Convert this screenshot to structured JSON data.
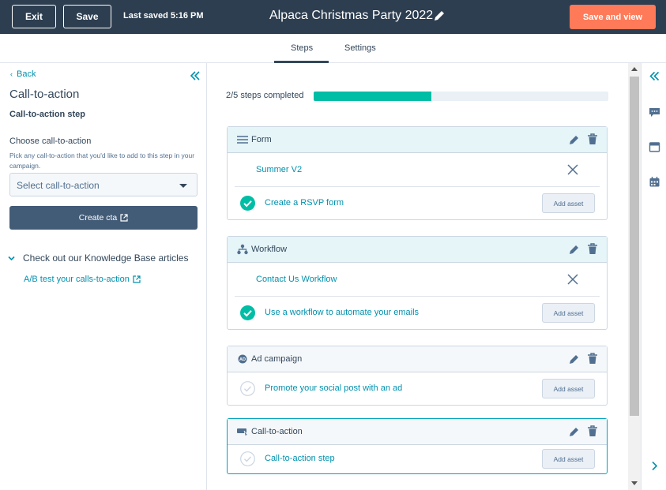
{
  "header": {
    "exit_label": "Exit",
    "save_label": "Save",
    "last_saved": "Last saved 5:16 PM",
    "title": "Alpaca Christmas Party 2022",
    "save_view_label": "Save and view"
  },
  "tabs": [
    {
      "label": "Steps",
      "active": true
    },
    {
      "label": "Settings",
      "active": false
    }
  ],
  "left_panel": {
    "back_label": "Back",
    "title": "Call-to-action",
    "subtitle": "Call-to-action step",
    "choose_label": "Choose call-to-action",
    "help_text": "Pick any call-to-action that you'd like to add to this step in your campaign.",
    "select_placeholder": "Select call-to-action",
    "create_cta_label": "Create cta",
    "kb_header": "Check out our Knowledge Base articles",
    "kb_link": "A/B test your calls-to-action"
  },
  "progress": {
    "label": "2/5 steps completed",
    "completed": 2,
    "total": 5,
    "fraction": 0.4
  },
  "steps": [
    {
      "title": "Form",
      "icon": "list-icon",
      "asset": "Summer V2",
      "task": "Create a RSVP form",
      "task_done": true,
      "add_label": "Add asset"
    },
    {
      "title": "Workflow",
      "icon": "workflow-icon",
      "asset": "Contact Us Workflow",
      "task": "Use a workflow to automate your emails",
      "task_done": true,
      "add_label": "Add asset"
    },
    {
      "title": "Ad campaign",
      "icon": "ads-icon",
      "task": "Promote your social post with an ad",
      "task_done": false,
      "add_label": "Add asset"
    },
    {
      "title": "Call-to-action",
      "icon": "cta-icon",
      "task": "Call-to-action step",
      "task_done": false,
      "add_label": "Add asset"
    }
  ],
  "colors": {
    "topbar": "#2d3e50",
    "accent_orange": "#ff7a59",
    "teal": "#00bda5",
    "link": "#0091ae",
    "cta_button": "#425b76"
  }
}
